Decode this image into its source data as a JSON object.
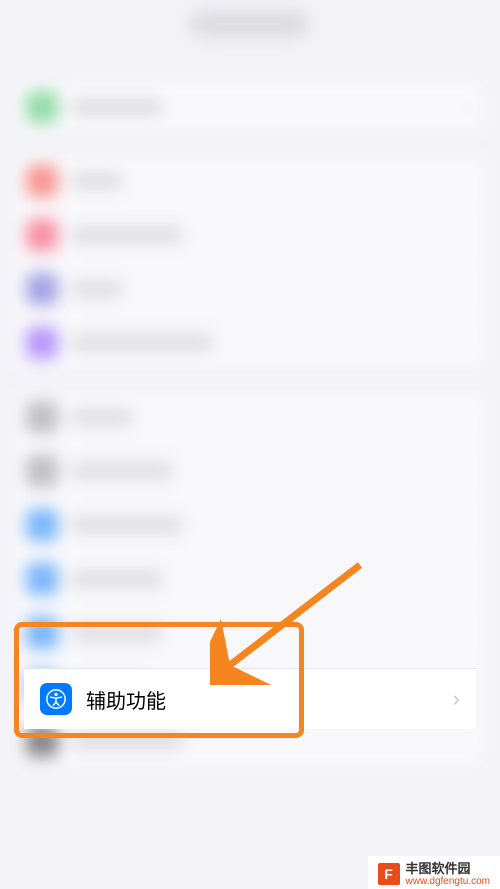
{
  "page_description": "iOS Settings screen (blurred) with highlighted Accessibility row",
  "highlighted_row": {
    "label": "辅助功能",
    "icon": "accessibility-icon",
    "icon_bg": "#007aff"
  },
  "annotation": {
    "box_color": "#f5851f",
    "arrow_color": "#f5851f"
  },
  "watermark": {
    "logo_letter": "F",
    "name": "丰图软件园",
    "url": "www.dgfengtu.com"
  },
  "blurred_sections": [
    {
      "rows": [
        {
          "icon_color": "green"
        }
      ]
    },
    {
      "rows": [
        {
          "icon_color": "red"
        },
        {
          "icon_color": "pink"
        },
        {
          "icon_color": "purple"
        },
        {
          "icon_color": "purple2"
        }
      ]
    },
    {
      "rows": [
        {
          "icon_color": "grey"
        },
        {
          "icon_color": "grey"
        },
        {
          "icon_color": "blue"
        },
        {
          "icon_color": "blue"
        },
        {
          "icon_color": "blue",
          "accessibility_target": true
        },
        {
          "icon_color": "blue"
        },
        {
          "icon_color": "dark"
        }
      ]
    }
  ]
}
